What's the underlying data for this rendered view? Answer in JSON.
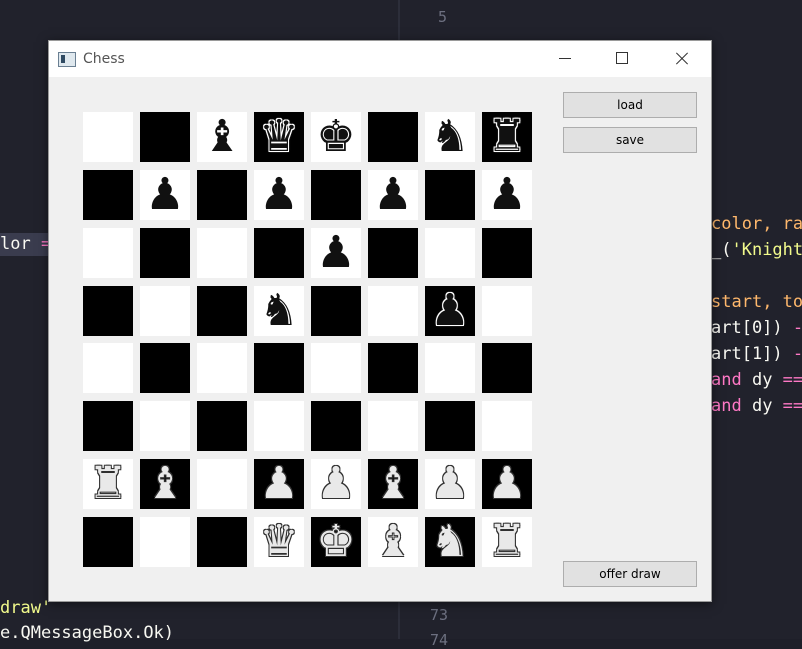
{
  "editor": {
    "left_lines": [
      {
        "row": 0,
        "segments": [
          {
            "t": "lor",
            "c": "txt"
          },
          {
            "t": " =",
            "c": "op"
          }
        ]
      },
      {
        "row": 1,
        "segments": [
          {
            "t": "draw'",
            "c": "str"
          }
        ]
      },
      {
        "row": 2,
        "segments": [
          {
            "t": "e.",
            "c": "txt"
          },
          {
            "t": "QMessageBox",
            "c": "txt"
          },
          {
            "t": ".Ok)",
            "c": "txt"
          }
        ]
      }
    ],
    "right_line_numbers": [
      "5",
      "73",
      "74"
    ],
    "right_lines": [
      {
        "segments": [
          {
            "t": "color",
            "c": "par"
          },
          {
            "t": ", ra",
            "c": "par"
          }
        ]
      },
      {
        "segments": [
          {
            "t": "_(",
            "c": "txt"
          },
          {
            "t": "'Knight",
            "c": "str"
          }
        ]
      },
      {
        "segments": [
          {
            "t": "start",
            "c": "par"
          },
          {
            "t": ", to",
            "c": "par"
          }
        ]
      },
      {
        "segments": [
          {
            "t": "art[0]) ",
            "c": "txt"
          },
          {
            "t": "-",
            "c": "op"
          }
        ]
      },
      {
        "segments": [
          {
            "t": "art[1]) ",
            "c": "txt"
          },
          {
            "t": "-",
            "c": "op"
          }
        ]
      },
      {
        "segments": [
          {
            "t": "and",
            "c": "kw"
          },
          {
            "t": " dy ",
            "c": "txt"
          },
          {
            "t": "==",
            "c": "op"
          }
        ]
      },
      {
        "segments": [
          {
            "t": "and",
            "c": "kw"
          },
          {
            "t": " dy ",
            "c": "txt"
          },
          {
            "t": "==",
            "c": "op"
          }
        ]
      }
    ],
    "colors": {
      "bg": "#21222c",
      "keyword": "#ff79c6",
      "string": "#f1fa8c",
      "param": "#ffb86c"
    }
  },
  "window": {
    "title": "Chess",
    "buttons": {
      "load": "load",
      "save": "save",
      "offer_draw": "offer draw"
    }
  },
  "board": {
    "rows": [
      [
        "",
        "",
        "b♝",
        "b♛",
        "b♚",
        "",
        "b♞",
        "b♜"
      ],
      [
        "",
        "b♟",
        "",
        "b♟",
        "",
        "b♟",
        "",
        "b♟"
      ],
      [
        "",
        "",
        "",
        "",
        "b♟",
        "",
        "",
        ""
      ],
      [
        "",
        "",
        "",
        "b♞",
        "",
        "",
        "b♟",
        ""
      ],
      [
        "",
        "",
        "",
        "",
        "",
        "",
        "",
        ""
      ],
      [
        "",
        "",
        "",
        "",
        "",
        "",
        "",
        ""
      ],
      [
        "w♜",
        "w♝",
        "",
        "w♟",
        "w♟",
        "w♝",
        "w♟",
        "w♟"
      ],
      [
        "",
        "",
        "",
        "w♛",
        "w♚",
        "w♝",
        "w♞",
        "w♜"
      ]
    ],
    "colors": {
      "light": "#ffffff",
      "dark": "#000000"
    }
  }
}
